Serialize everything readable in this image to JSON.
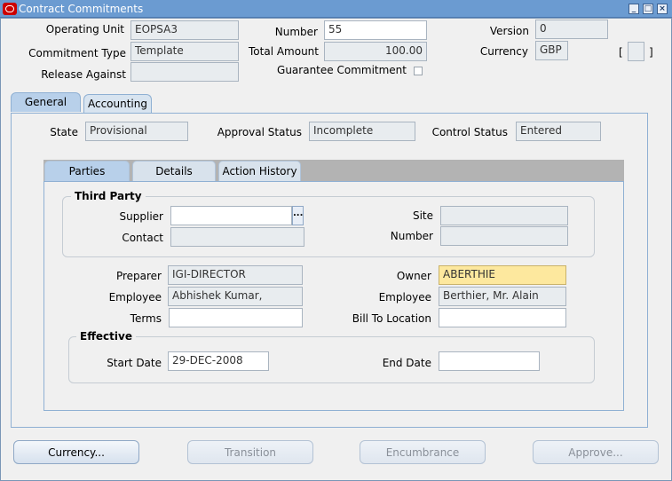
{
  "window": {
    "title": "Contract Commitments"
  },
  "header": {
    "operating_unit_label": "Operating Unit",
    "operating_unit_value": "EOPSA3",
    "number_label": "Number",
    "number_value": "55",
    "version_label": "Version",
    "version_value": "0",
    "commitment_type_label": "Commitment Type",
    "commitment_type_value": "Template",
    "total_amount_label": "Total Amount",
    "total_amount_value": "100.00",
    "currency_label": "Currency",
    "currency_value": "GBP",
    "release_against_label": "Release Against",
    "release_against_value": "",
    "guarantee_label": "Guarantee Commitment",
    "bracket_left": "[",
    "bracket_right": "]"
  },
  "main_tabs": [
    {
      "label": "General"
    },
    {
      "label": "Accounting"
    }
  ],
  "status": {
    "state_label": "State",
    "state_value": "Provisional",
    "approval_label": "Approval Status",
    "approval_value": "Incomplete",
    "control_label": "Control Status",
    "control_value": "Entered"
  },
  "sub_tabs": [
    {
      "label": "Parties"
    },
    {
      "label": "Details"
    },
    {
      "label": "Action History"
    }
  ],
  "third_party": {
    "title": "Third Party",
    "supplier_label": "Supplier",
    "supplier_value": "",
    "site_label": "Site",
    "site_value": "",
    "contact_label": "Contact",
    "contact_value": "",
    "number_label": "Number",
    "number_value": "",
    "lov_glyph": "..."
  },
  "people": {
    "preparer_label": "Preparer",
    "preparer_value": "IGI-DIRECTOR",
    "owner_label": "Owner",
    "owner_value": "ABERTHIE",
    "employee1_label": "Employee",
    "employee1_value": "Abhishek Kumar,",
    "employee2_label": "Employee",
    "employee2_value": "Berthier, Mr. Alain",
    "terms_label": "Terms",
    "terms_value": "",
    "bill_to_label": "Bill To Location",
    "bill_to_value": ""
  },
  "effective": {
    "title": "Effective",
    "start_label": "Start Date",
    "start_value": "29-DEC-2008",
    "end_label": "End Date",
    "end_value": ""
  },
  "buttons": {
    "currency": "Currency...",
    "transition": "Transition",
    "encumbrance": "Encumbrance",
    "approve": "Approve..."
  }
}
